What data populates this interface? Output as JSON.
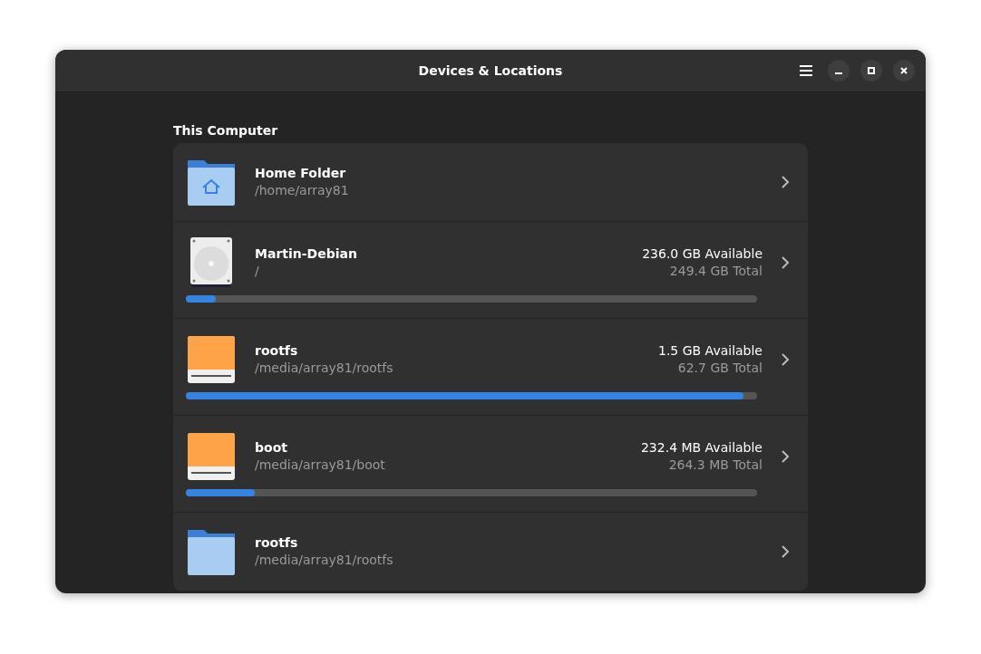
{
  "window": {
    "title": "Devices & Locations"
  },
  "section": {
    "title": "This Computer"
  },
  "places": [
    {
      "kind": "home",
      "name": "Home Folder",
      "path": "/home/array81"
    },
    {
      "kind": "disk",
      "name": "Martin-Debian",
      "path": "/",
      "available": "236.0 GB Available",
      "total": "249.4 GB Total",
      "level": 0.053
    },
    {
      "kind": "drive",
      "name": "rootfs",
      "path": "/media/array81/rootfs",
      "available": "1.5 GB Available",
      "total": "62.7 GB Total",
      "level": 0.976
    },
    {
      "kind": "drive",
      "name": "boot",
      "path": "/media/array81/boot",
      "available": "232.4 MB Available",
      "total": "264.3 MB Total",
      "level": 0.12
    },
    {
      "kind": "folder",
      "name": "rootfs",
      "path": "/media/array81/rootfs"
    }
  ]
}
